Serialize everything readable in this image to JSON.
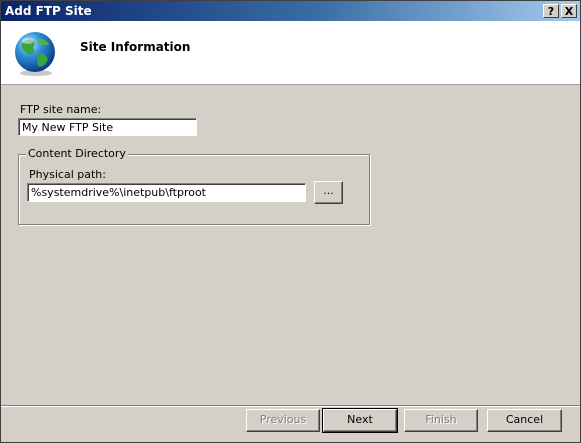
{
  "window": {
    "title": "Add FTP Site",
    "help_glyph": "?",
    "close_glyph": "X"
  },
  "header": {
    "title": "Site Information",
    "icon": "globe-icon"
  },
  "form": {
    "site_name_label": "FTP site name:",
    "site_name_value": "My New FTP Site",
    "content_group_label": "Content Directory",
    "physical_path_label": "Physical path:",
    "physical_path_value": "%systemdrive%\\inetpub\\ftproot",
    "browse_label": "..."
  },
  "buttons": {
    "previous": "Previous",
    "next": "Next",
    "finish": "Finish",
    "cancel": "Cancel"
  }
}
